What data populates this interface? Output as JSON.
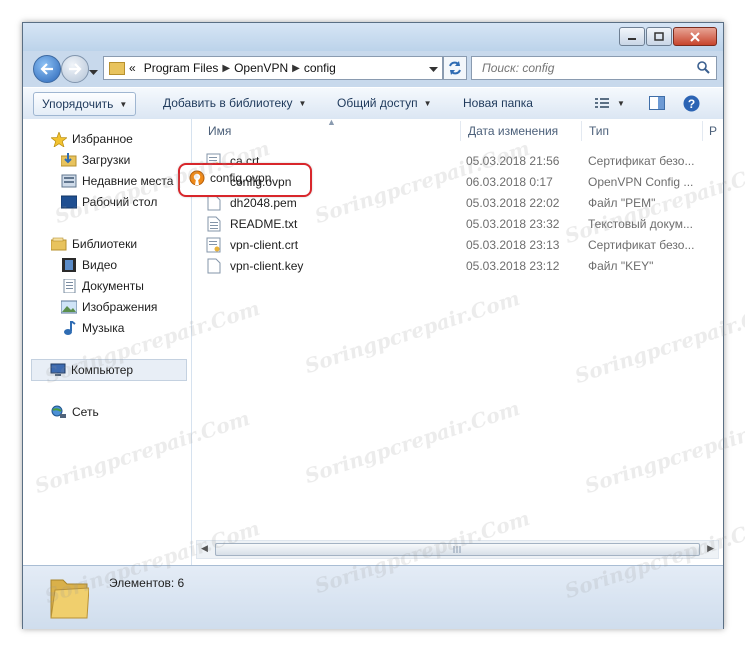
{
  "address": {
    "overflow_chevron": "«",
    "crumbs": [
      "Program Files",
      "OpenVPN",
      "config"
    ],
    "search_placeholder": "Поиск: config"
  },
  "toolbar": {
    "organize": "Упорядочить",
    "add_library": "Добавить в библиотеку",
    "share": "Общий доступ",
    "new_folder": "Новая папка"
  },
  "sidebar": {
    "favorites": "Избранное",
    "downloads": "Загрузки",
    "recent": "Недавние места",
    "desktop": "Рабочий стол",
    "libraries": "Библиотеки",
    "video": "Видео",
    "documents": "Документы",
    "images": "Изображения",
    "music": "Музыка",
    "computer": "Компьютер",
    "network": "Сеть"
  },
  "columns": {
    "name": "Имя",
    "date": "Дата изменения",
    "type": "Тип",
    "size_partial": "Р"
  },
  "files": [
    {
      "name": "ca.crt",
      "date": "05.03.2018 21:56",
      "type": "Сертификат безо...",
      "icon": "certificate-icon"
    },
    {
      "name": "config.ovpn",
      "date": "06.03.2018 0:17",
      "type": "OpenVPN Config ...",
      "icon": "openvpn-icon"
    },
    {
      "name": "dh2048.pem",
      "date": "05.03.2018 22:02",
      "type": "Файл \"PEM\"",
      "icon": "file-icon"
    },
    {
      "name": "README.txt",
      "date": "05.03.2018 23:32",
      "type": "Текстовый докум...",
      "icon": "text-file-icon"
    },
    {
      "name": "vpn-client.crt",
      "date": "05.03.2018 23:13",
      "type": "Сертификат безо...",
      "icon": "certificate-icon"
    },
    {
      "name": "vpn-client.key",
      "date": "05.03.2018 23:12",
      "type": "Файл \"KEY\"",
      "icon": "file-icon"
    }
  ],
  "status": {
    "items_count": "Элементов: 6"
  },
  "watermark": "Soringpcrepair.Com"
}
